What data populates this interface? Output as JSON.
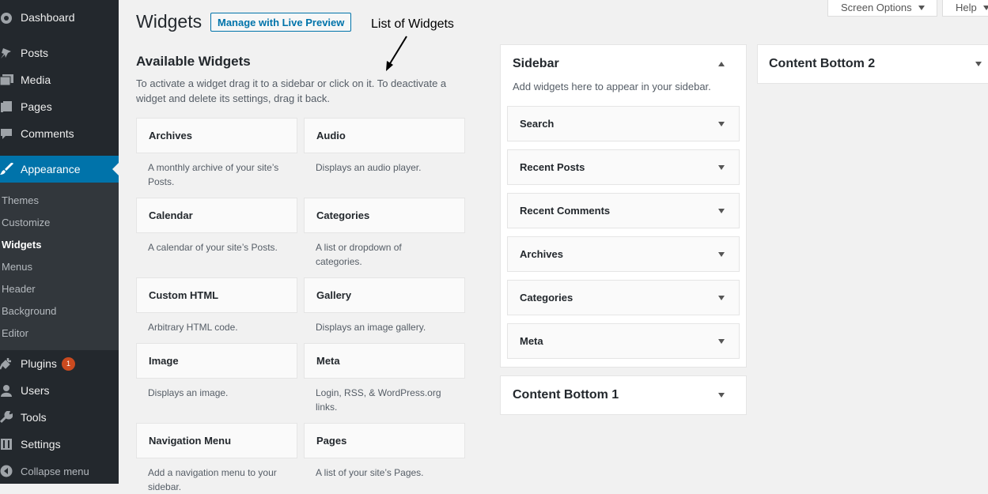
{
  "menu": {
    "dashboard": "Dashboard",
    "posts": "Posts",
    "media": "Media",
    "pages": "Pages",
    "comments": "Comments",
    "appearance": "Appearance",
    "submenu": [
      "Themes",
      "Customize",
      "Widgets",
      "Menus",
      "Header",
      "Background",
      "Editor"
    ],
    "plugins": "Plugins",
    "plugins_badge": "1",
    "users": "Users",
    "tools": "Tools",
    "settings": "Settings",
    "collapse": "Collapse menu"
  },
  "top_tabs": {
    "screen_options": "Screen Options",
    "help": "Help"
  },
  "header": {
    "title": "Widgets",
    "live_preview": "Manage with Live Preview",
    "annotation": "List of Widgets"
  },
  "available": {
    "title": "Available Widgets",
    "description": "To activate a widget drag it to a sidebar or click on it. To deactivate a widget and delete its settings, drag it back.",
    "widgets": [
      {
        "name": "Archives",
        "desc": "A monthly archive of your site’s Posts."
      },
      {
        "name": "Audio",
        "desc": "Displays an audio player."
      },
      {
        "name": "Calendar",
        "desc": "A calendar of your site’s Posts."
      },
      {
        "name": "Categories",
        "desc": "A list or dropdown of categories."
      },
      {
        "name": "Custom HTML",
        "desc": "Arbitrary HTML code."
      },
      {
        "name": "Gallery",
        "desc": "Displays an image gallery."
      },
      {
        "name": "Image",
        "desc": "Displays an image."
      },
      {
        "name": "Meta",
        "desc": "Login, RSS, & WordPress.org links."
      },
      {
        "name": "Navigation Menu",
        "desc": "Add a navigation menu to your sidebar."
      },
      {
        "name": "Pages",
        "desc": "A list of your site’s Pages."
      }
    ]
  },
  "sidebar_area": {
    "title": "Sidebar",
    "description": "Add widgets here to appear in your sidebar.",
    "widgets": [
      "Search",
      "Recent Posts",
      "Recent Comments",
      "Archives",
      "Categories",
      "Meta"
    ]
  },
  "content_bottom_1": {
    "title": "Content Bottom 1"
  },
  "content_bottom_2": {
    "title": "Content Bottom 2"
  }
}
